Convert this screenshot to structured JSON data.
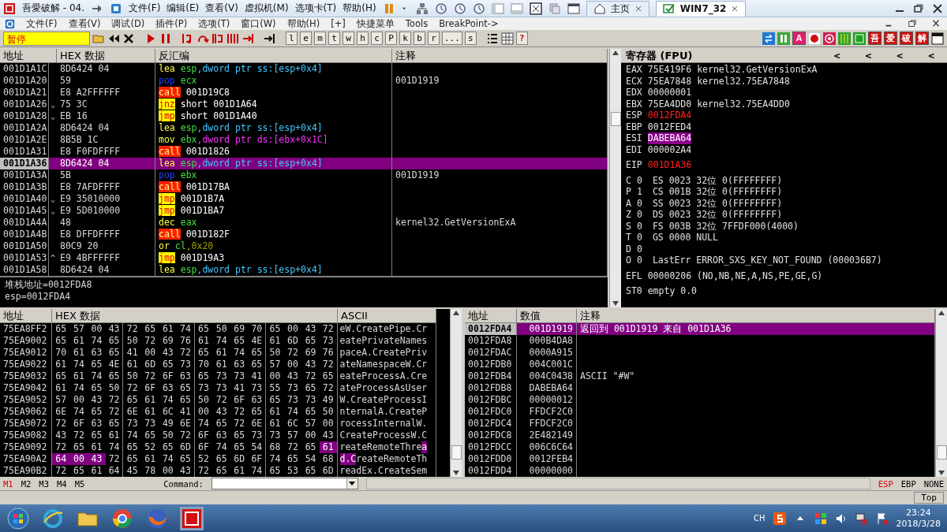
{
  "vm_window": {
    "title": "吾愛破解 - 04.",
    "menu": [
      "文件(F)",
      "编辑(E)",
      "查看(V)",
      "虚拟机(M)",
      "选项卡(T)",
      "帮助(H)"
    ],
    "tabs": [
      {
        "label": "主页",
        "selected": false
      },
      {
        "label": "WIN7_32",
        "selected": true
      }
    ]
  },
  "olly": {
    "menu": [
      "文件(F)",
      "查看(V)",
      "调试(D)",
      "插件(P)",
      "选项(T)",
      "窗口(W)",
      "帮助(H)",
      "[+]",
      "快捷菜单",
      "Tools",
      "BreakPoint->"
    ],
    "status": "暂停",
    "letter_buttons": [
      "l",
      "e",
      "m",
      "t",
      "w",
      "h",
      "c",
      "P",
      "k",
      "b",
      "r",
      "...",
      "s"
    ],
    "help_button": "?",
    "plugin_buttons": [
      {
        "label": "A",
        "color": "#e0206a"
      },
      {
        "label": "吾",
        "color": "#d01010"
      },
      {
        "label": "爱",
        "color": "#d01010"
      },
      {
        "label": "破",
        "color": "#d01010"
      },
      {
        "label": "解",
        "color": "#d01010"
      }
    ]
  },
  "disasm": {
    "columns": [
      "地址",
      "HEX 数据",
      "反汇编",
      "注释"
    ],
    "rows": [
      {
        "address": "001D1A1C",
        "hex": "8D6424 04",
        "mnemonic": "lea",
        "kind": "plain",
        "operands": [
          {
            "text": "esp",
            "kind": "reg"
          },
          {
            "text": ",dword ptr ss:[esp+0x4]",
            "kind": "mem_ss"
          }
        ],
        "selected": false
      },
      {
        "address": "001D1A20",
        "hex": "59",
        "mnemonic": "pop",
        "kind": "stack",
        "operands": [
          {
            "text": "ecx",
            "kind": "reg"
          }
        ],
        "comment": "001D1919",
        "selected": false
      },
      {
        "address": "001D1A21",
        "hex": "E8 A2FFFFFF",
        "mnemonic": "call",
        "kind": "call",
        "operands": [
          {
            "text": "001D19C8",
            "kind": "target"
          }
        ],
        "selected": false
      },
      {
        "address": "001D1A26",
        "mark": "⌄",
        "hex": "75 3C",
        "mnemonic": "jnz",
        "kind": "jump",
        "operands": [
          {
            "text": "short 001D1A64",
            "kind": "target"
          }
        ],
        "selected": false
      },
      {
        "address": "001D1A28",
        "mark": "⌄",
        "hex": "EB 16",
        "mnemonic": "jmp",
        "kind": "jump",
        "operands": [
          {
            "text": "short 001D1A40",
            "kind": "target"
          }
        ],
        "selected": false
      },
      {
        "address": "001D1A2A",
        "hex": "8D6424 04",
        "mnemonic": "lea",
        "kind": "plain",
        "operands": [
          {
            "text": "esp",
            "kind": "reg"
          },
          {
            "text": ",dword ptr ss:[esp+0x4]",
            "kind": "mem_ss"
          }
        ],
        "selected": false
      },
      {
        "address": "001D1A2E",
        "hex": "8B5B 1C",
        "mnemonic": "mov",
        "kind": "plain",
        "operands": [
          {
            "text": "ebx",
            "kind": "reg"
          },
          {
            "text": ",dword ptr ds:[ebx+0x1C]",
            "kind": "mem_ds"
          }
        ],
        "selected": false
      },
      {
        "address": "001D1A31",
        "hex": "E8 F0FDFFFF",
        "mnemonic": "call",
        "kind": "call",
        "operands": [
          {
            "text": "001D1826",
            "kind": "target"
          }
        ],
        "selected": false
      },
      {
        "address": "001D1A36",
        "hex": "8D6424 04",
        "mnemonic": "lea",
        "kind": "plain",
        "operands": [
          {
            "text": "esp",
            "kind": "reg"
          },
          {
            "text": ",dword ptr ss:[esp+0x4]",
            "kind": "mem_ss"
          }
        ],
        "selected": true
      },
      {
        "address": "001D1A3A",
        "hex": "5B",
        "mnemonic": "pop",
        "kind": "stack",
        "operands": [
          {
            "text": "ebx",
            "kind": "reg"
          }
        ],
        "comment": "001D1919",
        "selected": false
      },
      {
        "address": "001D1A3B",
        "hex": "E8 7AFDFFFF",
        "mnemonic": "call",
        "kind": "call",
        "operands": [
          {
            "text": "001D17BA",
            "kind": "target"
          }
        ],
        "selected": false
      },
      {
        "address": "001D1A40",
        "mark": "⌄",
        "hex": "E9 35010000",
        "mnemonic": "jmp",
        "kind": "jump",
        "operands": [
          {
            "text": "001D1B7A",
            "kind": "target"
          }
        ],
        "selected": false
      },
      {
        "address": "001D1A45",
        "mark": "⌄",
        "hex": "E9 5D010000",
        "mnemonic": "jmp",
        "kind": "jump",
        "operands": [
          {
            "text": "001D1BA7",
            "kind": "target"
          }
        ],
        "selected": false
      },
      {
        "address": "001D1A4A",
        "hex": "48",
        "mnemonic": "dec",
        "kind": "plain",
        "operands": [
          {
            "text": "eax",
            "kind": "reg"
          }
        ],
        "comment": "kernel32.GetVersionExA",
        "selected": false
      },
      {
        "address": "001D1A4B",
        "hex": "E8 DFFDFFFF",
        "mnemonic": "call",
        "kind": "call",
        "operands": [
          {
            "text": "001D182F",
            "kind": "target"
          }
        ],
        "selected": false
      },
      {
        "address": "001D1A50",
        "hex": "80C9 20",
        "mnemonic": "or",
        "kind": "plain",
        "operands": [
          {
            "text": "cl",
            "kind": "reg"
          },
          {
            "text": ",0x20",
            "kind": "imm"
          }
        ],
        "selected": false
      },
      {
        "address": "001D1A53",
        "mark": "^",
        "hex": "E9 4BFFFFFF",
        "mnemonic": "jmp",
        "kind": "jump",
        "operands": [
          {
            "text": "001D19A3",
            "kind": "target"
          }
        ],
        "selected": false
      },
      {
        "address": "001D1A58",
        "hex": "8D6424 04",
        "mnemonic": "lea",
        "kind": "plain",
        "operands": [
          {
            "text": "esp",
            "kind": "reg"
          },
          {
            "text": ",dword ptr ss:[esp+0x4]",
            "kind": "mem_ss"
          }
        ],
        "selected": false
      }
    ]
  },
  "info": [
    "堆栈地址=0012FDA8",
    "esp=0012FDA4"
  ],
  "registers": {
    "title": "寄存器 (FPU)",
    "nav_buttons": [
      "<",
      "<",
      "<",
      "<"
    ],
    "general": [
      {
        "name": "EAX",
        "value": "75E419F6",
        "comment": "kernel32.GetVersionExA",
        "changed": false,
        "selected": false
      },
      {
        "name": "ECX",
        "value": "75EA7848",
        "comment": "kernel32.75EA7848",
        "changed": false,
        "selected": false
      },
      {
        "name": "EDX",
        "value": "00000001",
        "changed": false,
        "selected": false
      },
      {
        "name": "EBX",
        "value": "75EA4DD0",
        "comment": "kernel32.75EA4DD0",
        "changed": false,
        "selected": false
      },
      {
        "name": "ESP",
        "value": "0012FDA4",
        "changed": true,
        "selected": false
      },
      {
        "name": "EBP",
        "value": "0012FED4",
        "changed": false,
        "selected": false
      },
      {
        "name": "ESI",
        "value": "DABEBA64",
        "changed": false,
        "selected": true
      },
      {
        "name": "EDI",
        "value": "000002A4",
        "changed": false,
        "selected": false
      }
    ],
    "eip": {
      "name": "EIP",
      "value": "001D1A36",
      "changed": true
    },
    "flags": [
      {
        "flag": "C",
        "value": "0",
        "detail": "ES 0023 32位 0(FFFFFFFF)"
      },
      {
        "flag": "P",
        "value": "1",
        "detail": "CS 001B 32位 0(FFFFFFFF)"
      },
      {
        "flag": "A",
        "value": "0",
        "detail": "SS 0023 32位 0(FFFFFFFF)"
      },
      {
        "flag": "Z",
        "value": "0",
        "detail": "DS 0023 32位 0(FFFFFFFF)"
      },
      {
        "flag": "S",
        "value": "0",
        "detail": "FS 003B 32位 7FFDF000(4000)"
      },
      {
        "flag": "T",
        "value": "0",
        "detail": "GS 0000 NULL"
      },
      {
        "flag": "D",
        "value": "0"
      },
      {
        "flag": "O",
        "value": "0",
        "detail": "LastErr ERROR_SXS_KEY_NOT_FOUND (000036B7)"
      }
    ],
    "efl": "EFL 00000206 (NO,NB,NE,A,NS,PE,GE,G)",
    "fpu": "ST0 empty 0.0"
  },
  "dump": {
    "columns": [
      "地址",
      "HEX 数据",
      "ASCII"
    ],
    "rows": [
      {
        "address": "75EA8FF2",
        "hex": [
          {
            "text": "65 57 00 43 72 65 61 74 65 50 69 70 65 00 43 72",
            "selected": false
          }
        ],
        "ascii": [
          {
            "text": "eW.CreatePipe.Cr",
            "selected": false
          }
        ]
      },
      {
        "address": "75EA9002",
        "hex": [
          {
            "text": "65 61 74 65 50 72 69 76 61 74 65 4E 61 6D 65 73",
            "selected": false
          }
        ],
        "ascii": [
          {
            "text": "eatePrivateNames",
            "selected": false
          }
        ]
      },
      {
        "address": "75EA9012",
        "hex": [
          {
            "text": "70 61 63 65 41 00 43 72 65 61 74 65 50 72 69 76",
            "selected": false
          }
        ],
        "ascii": [
          {
            "text": "paceA.CreatePriv",
            "selected": false
          }
        ]
      },
      {
        "address": "75EA9022",
        "hex": [
          {
            "text": "61 74 65 4E 61 6D 65 73 70 61 63 65 57 00 43 72",
            "selected": false
          }
        ],
        "ascii": [
          {
            "text": "ateNamespaceW.Cr",
            "selected": false
          }
        ]
      },
      {
        "address": "75EA9032",
        "hex": [
          {
            "text": "65 61 74 65 50 72 6F 63 65 73 73 41 00 43 72 65",
            "selected": false
          }
        ],
        "ascii": [
          {
            "text": "eateProcessA.Cre",
            "selected": false
          }
        ]
      },
      {
        "address": "75EA9042",
        "hex": [
          {
            "text": "61 74 65 50 72 6F 63 65 73 73 41 73 55 73 65 72",
            "selected": false
          }
        ],
        "ascii": [
          {
            "text": "ateProcessAsUser",
            "selected": false
          }
        ]
      },
      {
        "address": "75EA9052",
        "hex": [
          {
            "text": "57 00 43 72 65 61 74 65 50 72 6F 63 65 73 73 49",
            "selected": false
          }
        ],
        "ascii": [
          {
            "text": "W.CreateProcessI",
            "selected": false
          }
        ]
      },
      {
        "address": "75EA9062",
        "hex": [
          {
            "text": "6E 74 65 72 6E 61 6C 41 00 43 72 65 61 74 65 50",
            "selected": false
          }
        ],
        "ascii": [
          {
            "text": "nternalA.CreateP",
            "selected": false
          }
        ]
      },
      {
        "address": "75EA9072",
        "hex": [
          {
            "text": "72 6F 63 65 73 73 49 6E 74 65 72 6E 61 6C 57 00",
            "selected": false
          }
        ],
        "ascii": [
          {
            "text": "rocessInternalW.",
            "selected": false
          }
        ]
      },
      {
        "address": "75EA9082",
        "hex": [
          {
            "text": "43 72 65 61 74 65 50 72 6F 63 65 73 73 57 00 43",
            "selected": false
          }
        ],
        "ascii": [
          {
            "text": "CreateProcessW.C",
            "selected": false
          }
        ]
      },
      {
        "address": "75EA9092",
        "hex": [
          {
            "text": "72 65 61 74 65 52 65 6D 6F 74 65 54 68 72 65",
            "selected": false
          },
          {
            "text": "61",
            "selected": true
          }
        ],
        "ascii": [
          {
            "text": "reateRemoteThre",
            "selected": false
          },
          {
            "text": "a",
            "selected": true
          }
        ]
      },
      {
        "address": "75EA90A2",
        "hex": [
          {
            "text": "64 00 43",
            "selected": true
          },
          {
            "text": "72 65 61 74 65 52 65 6D 6F 74 65 54 68",
            "selected": false
          }
        ],
        "ascii": [
          {
            "text": "d.C",
            "selected": true
          },
          {
            "text": "reateRemoteTh",
            "selected": false
          }
        ]
      },
      {
        "address": "75EA90B2",
        "hex": [
          {
            "text": "72 65 61 64 45 78 00 43 72 65 61 74 65 53 65 6D",
            "selected": false
          }
        ],
        "ascii": [
          {
            "text": "readEx.CreateSem",
            "selected": false
          }
        ]
      }
    ]
  },
  "stack": {
    "columns": [
      "地址",
      "数值",
      "注释"
    ],
    "rows": [
      {
        "address": "0012FDA4",
        "value": "001D1919",
        "comment": "返回到 001D1919 来自 001D1A36",
        "selected": true
      },
      {
        "address": "0012FDA8",
        "value": "000B4DA8",
        "selected": false
      },
      {
        "address": "0012FDAC",
        "value": "0000A915",
        "selected": false
      },
      {
        "address": "0012FDB0",
        "value": "004C001C",
        "selected": false
      },
      {
        "address": "0012FDB4",
        "value": "004C0438",
        "comment": "ASCII \"#W\"",
        "selected": false
      },
      {
        "address": "0012FDB8",
        "value": "DABEBA64",
        "selected": false
      },
      {
        "address": "0012FDBC",
        "value": "00000012",
        "selected": false
      },
      {
        "address": "0012FDC0",
        "value": "FFDCF2C0",
        "selected": false
      },
      {
        "address": "0012FDC4",
        "value": "FFDCF2C0",
        "selected": false
      },
      {
        "address": "0012FDC8",
        "value": "2E482149",
        "selected": false
      },
      {
        "address": "0012FDCC",
        "value": "006C6C64",
        "selected": false
      },
      {
        "address": "0012FDD0",
        "value": "0012FEB4",
        "selected": false
      },
      {
        "address": "0012FDD4",
        "value": "00000000",
        "selected": false
      }
    ]
  },
  "command_bar": {
    "marks": [
      {
        "label": "M1",
        "selected": true
      },
      {
        "label": "M2",
        "selected": false
      },
      {
        "label": "M3",
        "selected": false
      },
      {
        "label": "M4",
        "selected": false
      },
      {
        "label": "M5",
        "selected": false
      }
    ],
    "command_label": "Command:",
    "stack_modes": [
      {
        "label": "ESP",
        "selected": true
      },
      {
        "label": "EBP",
        "selected": false
      },
      {
        "label": "NONE",
        "selected": false
      }
    ]
  },
  "status_bar": {
    "text": "Top"
  },
  "taskbar": {
    "language": "CH",
    "time": "23:24",
    "date": "2018/3/28"
  }
}
